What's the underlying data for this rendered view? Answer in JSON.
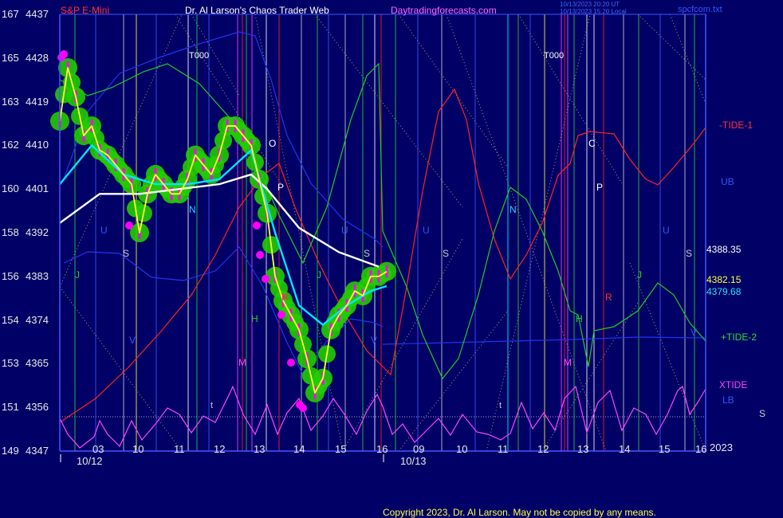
{
  "header": {
    "symbol": "S&P E-Mini",
    "author": "Dr. Al Larson's Chaos Trader Web",
    "site": "Daytradingforecasts.com",
    "stamp1": "10/13/2023 20:20 UT",
    "stamp2": "10/13/2023 15:20 Local",
    "file": "spcfcom.txt"
  },
  "copyright": "Copyright 2023, Dr. Al Larson. May not be copied by any means.",
  "colors": {
    "background": "#000066",
    "price": "#ffff33",
    "bars": "#ff00ff",
    "green_glow": "#22cc00",
    "ema_fast": "#00e5ff",
    "ema_slow": "#ffffff",
    "tide1": "#ff2222",
    "tide2": "#22cc22",
    "xtide": "#ff44ff",
    "band": "#2233ee"
  },
  "chart_data": {
    "type": "line",
    "title": "S&P E-Mini",
    "y_axis": {
      "ticks": [
        {
          "idx": "149",
          "price": "4347"
        },
        {
          "idx": "151",
          "price": "4356"
        },
        {
          "idx": "153",
          "price": "4365"
        },
        {
          "idx": "154",
          "price": "4374"
        },
        {
          "idx": "156",
          "price": "4383"
        },
        {
          "idx": "158",
          "price": "4392"
        },
        {
          "idx": "160",
          "price": "4401"
        },
        {
          "idx": "162",
          "price": "4410"
        },
        {
          "idx": "163",
          "price": "4419"
        },
        {
          "idx": "165",
          "price": "4428"
        },
        {
          "idx": "167",
          "price": "4437"
        }
      ],
      "range": [
        4347,
        4437
      ]
    },
    "x_axis": {
      "hour_ticks": [
        "03",
        "10",
        "11",
        "12",
        "13",
        "14",
        "15",
        "16",
        "09",
        "10",
        "11",
        "12",
        "13",
        "14",
        "15",
        "16"
      ],
      "dates": [
        "10/12",
        "10/13"
      ],
      "year": "2023"
    },
    "right_values": {
      "ub_value": "4388.35",
      "ema_fast_value": "4382.15",
      "ema_slow_value": "4379.68"
    },
    "legend": {
      "tide1": "-TIDE-1",
      "ub": "UB",
      "tide2": "+TIDE-2",
      "xtide": "XTIDE",
      "lb": "LB",
      "s": "S"
    },
    "markers": {
      "t000": "T000",
      "n": "N",
      "u": "U",
      "s": "S",
      "j": "J",
      "v": "V",
      "m": "M",
      "h": "H",
      "o": "O",
      "p": "P",
      "r": "R",
      "c": "C",
      "t": "t"
    },
    "series": [
      {
        "name": "price",
        "x": [
          0,
          1,
          2,
          3,
          4,
          5,
          6,
          7,
          8,
          9,
          10,
          11,
          12,
          13,
          14,
          15,
          16,
          17,
          18,
          19,
          20,
          21,
          22,
          23,
          24,
          25,
          26,
          27,
          28,
          29,
          30,
          31,
          32,
          33,
          34,
          35,
          36,
          37,
          38,
          39,
          40,
          41
        ],
        "y": [
          4415,
          4426,
          4420,
          4412,
          4414,
          4409,
          4408,
          4406,
          4404,
          4402,
          4392,
          4400,
          4404,
          4402,
          4400,
          4400,
          4403,
          4408,
          4406,
          4404,
          4408,
          4414,
          4414,
          4412,
          4410,
          4403,
          4396,
          4383,
          4378,
          4375,
          4372,
          4366,
          4359,
          4362,
          4372,
          4375,
          4377,
          4380,
          4379,
          4383,
          4383,
          4384
        ]
      },
      {
        "name": "ema_fast",
        "x": [
          0,
          4,
          8,
          12,
          16,
          20,
          24,
          27,
          30,
          33,
          36,
          39,
          41
        ],
        "y": [
          4402,
          4410,
          4404,
          4402,
          4402,
          4403,
          4409,
          4392,
          4377,
          4373,
          4377,
          4380,
          4381
        ]
      },
      {
        "name": "ema_slow",
        "x": [
          0,
          5,
          10,
          15,
          20,
          24,
          26,
          30,
          35,
          40
        ],
        "y": [
          4394,
          4400,
          4400,
          4401,
          4402,
          4404,
          4401,
          4393,
          4388,
          4385
        ]
      }
    ]
  }
}
